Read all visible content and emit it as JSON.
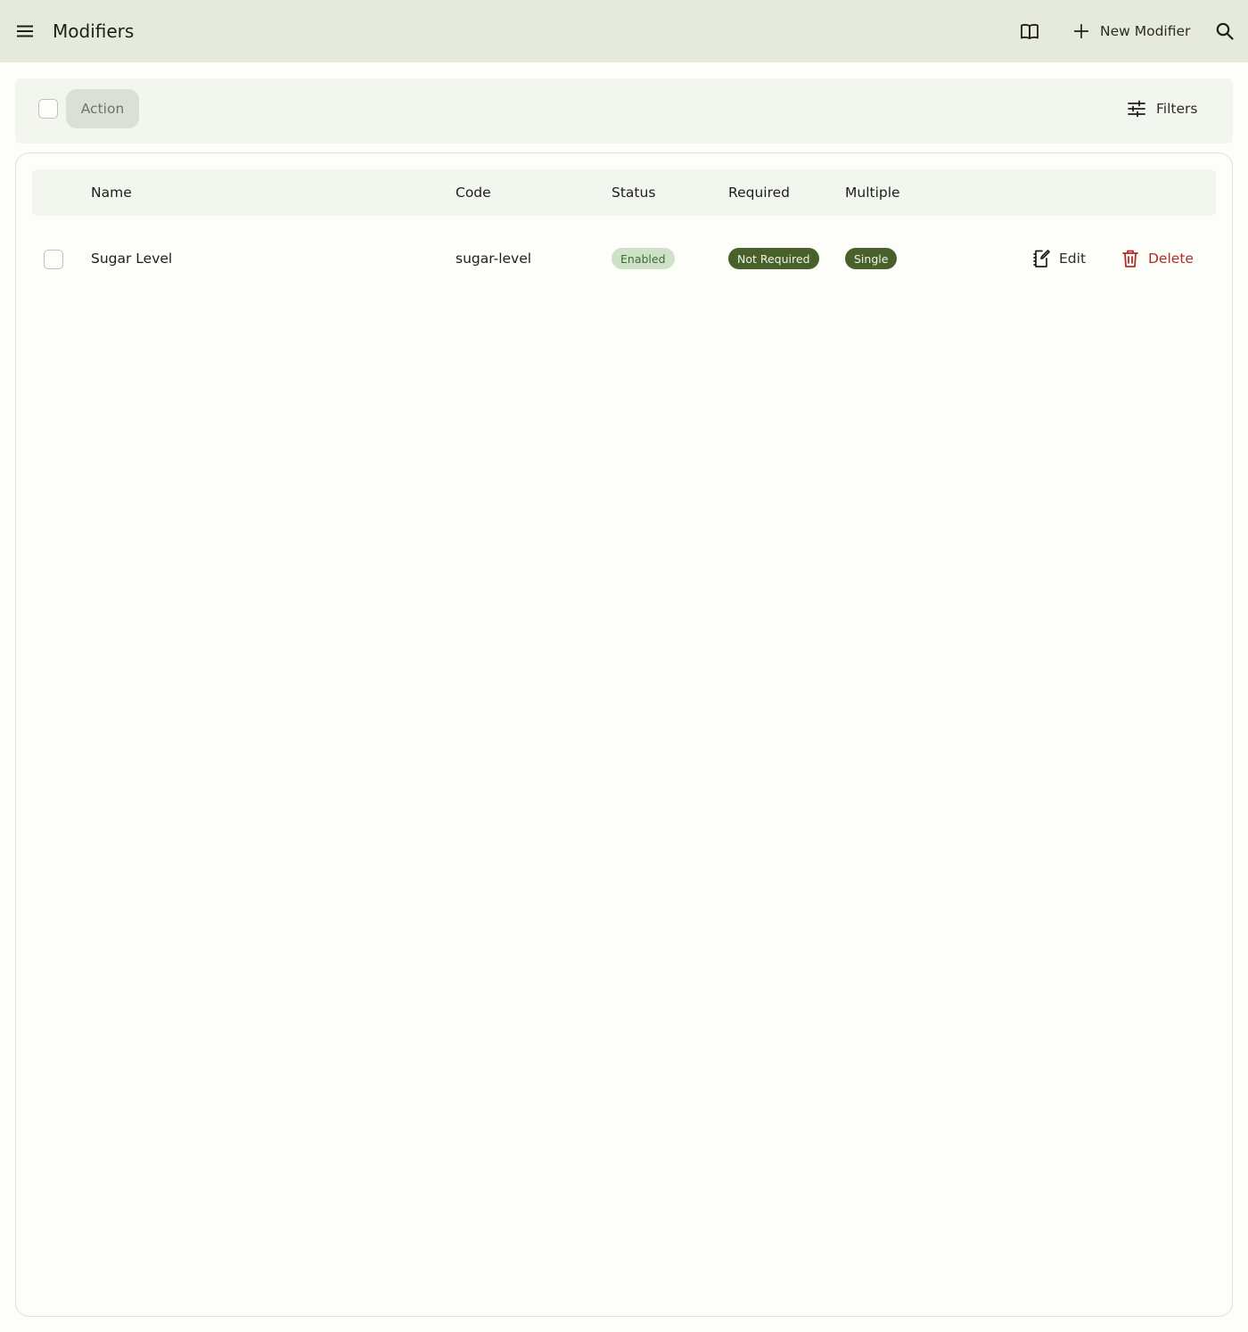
{
  "header": {
    "title": "Modifiers",
    "new_label": "New Modifier",
    "icons": {
      "menu": "menu-icon",
      "docs": "book-icon",
      "add": "plus-icon",
      "search": "search-icon"
    }
  },
  "toolbar": {
    "action_label": "Action",
    "filters_label": "Filters"
  },
  "table": {
    "columns": [
      "Name",
      "Code",
      "Status",
      "Required",
      "Multiple"
    ],
    "rows": [
      {
        "name": "Sugar Level",
        "code": "sugar-level",
        "status": "Enabled",
        "required": "Not Required",
        "multiple": "Single",
        "edit_label": "Edit",
        "delete_label": "Delete"
      }
    ]
  },
  "colors": {
    "topbar": "#e5eadd",
    "panel": "#f3f6ee",
    "badge_enabled_bg": "#cde2c6",
    "badge_dark_bg": "#48612a",
    "danger": "#b32a2a"
  }
}
